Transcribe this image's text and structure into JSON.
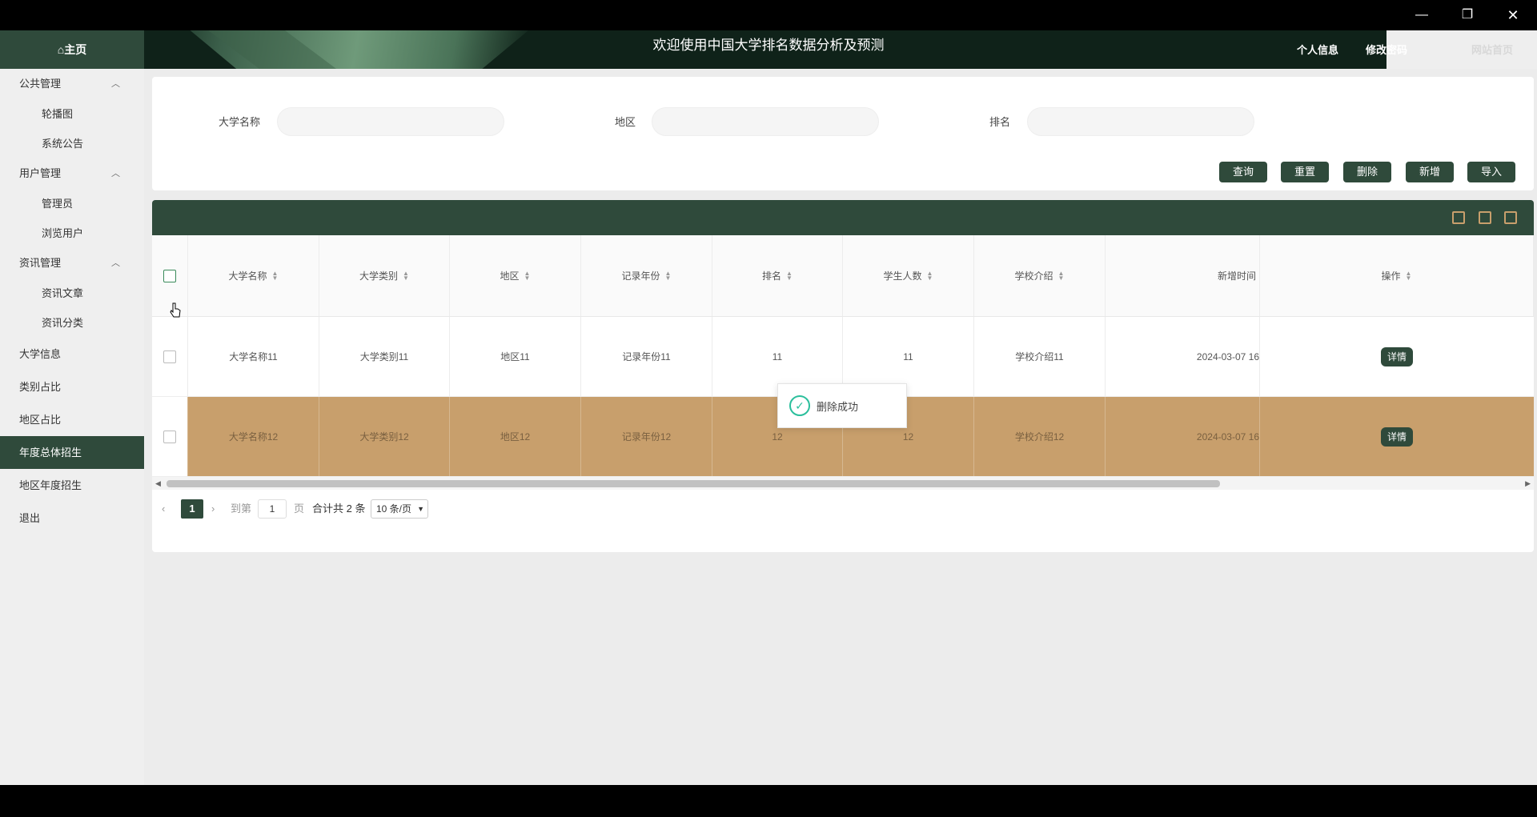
{
  "window": {
    "min_glyph": "—",
    "max_glyph": "❐",
    "close_glyph": "✕"
  },
  "header": {
    "title": "欢迎使用中国大学排名数据分析及预测",
    "links": [
      "个人信息",
      "修改密码",
      "网站首页"
    ]
  },
  "sidebar": {
    "home": "⌂主页",
    "groups": [
      {
        "label": "公共管理",
        "items": [
          "轮播图",
          "系统公告"
        ]
      },
      {
        "label": "用户管理",
        "items": [
          "管理员",
          "浏览用户"
        ]
      },
      {
        "label": "资讯管理",
        "items": [
          "资讯文章",
          "资讯分类"
        ]
      }
    ],
    "items": [
      "大学信息",
      "类别占比",
      "地区占比",
      "年度总体招生",
      "地区年度招生",
      "退出"
    ],
    "active_item": "年度总体招生"
  },
  "search": {
    "fields": [
      {
        "label": "大学名称",
        "value": ""
      },
      {
        "label": "地区",
        "value": ""
      },
      {
        "label": "排名",
        "value": ""
      }
    ],
    "buttons": [
      "查询",
      "重置",
      "删除",
      "新增",
      "导入"
    ]
  },
  "toolbar_icons": [
    "table-icon",
    "image-icon",
    "export-icon"
  ],
  "table": {
    "columns": [
      "大学名称",
      "大学类别",
      "地区",
      "记录年份",
      "排名",
      "学生人数",
      "学校介绍",
      "新增时间",
      "操作"
    ],
    "rows": [
      {
        "name": "大学名称11",
        "category": "大学类别11",
        "region": "地区11",
        "year": "记录年份11",
        "rank": "11",
        "students": "11",
        "intro": "学校介绍11",
        "time": "2024-03-07 16",
        "action": "详情",
        "selected": false
      },
      {
        "name": "大学名称12",
        "category": "大学类别12",
        "region": "地区12",
        "year": "记录年份12",
        "rank": "12",
        "students": "12",
        "intro": "学校介绍12",
        "time": "2024-03-07 16",
        "action": "详情",
        "selected": false
      }
    ]
  },
  "pagination": {
    "prev": "‹",
    "current": "1",
    "next": "›",
    "goto_label": "到第",
    "goto_value": "1",
    "page_label": "页",
    "total": "合计共 2 条",
    "page_size": "10 条/页"
  },
  "toast": {
    "message": "删除成功"
  }
}
